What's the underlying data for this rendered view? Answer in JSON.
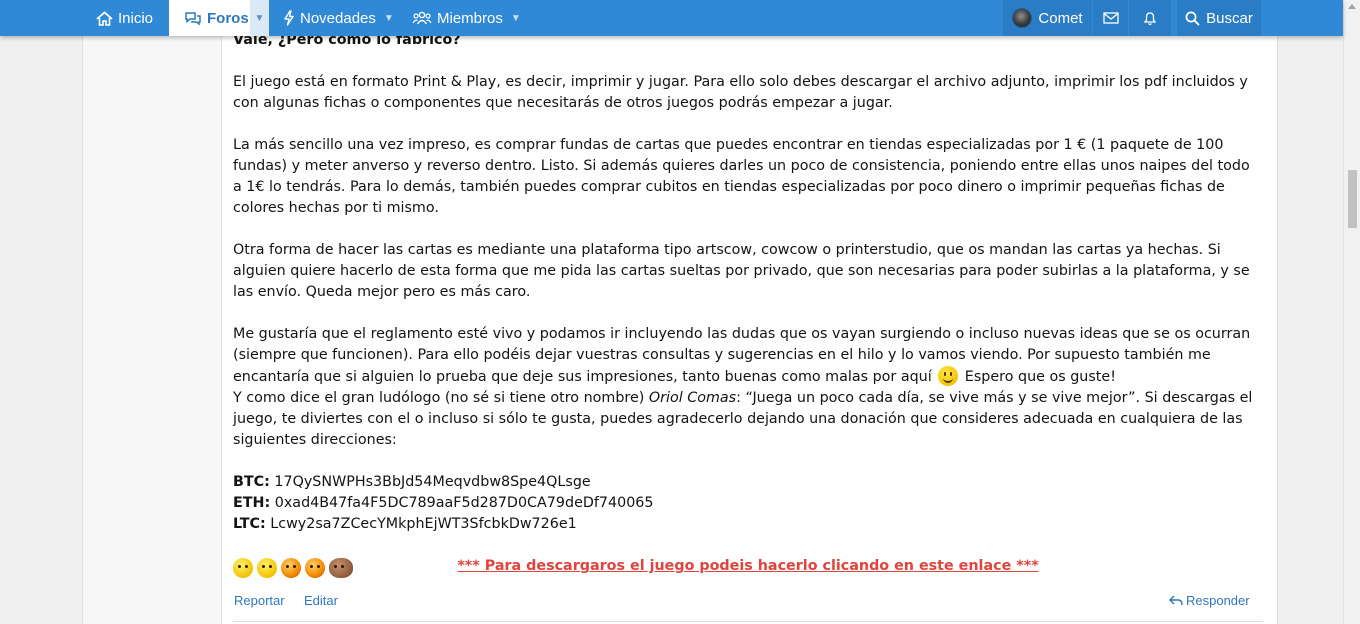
{
  "nav": {
    "home_label": "Inicio",
    "forums_label": "Foros",
    "news_label": "Novedades",
    "members_label": "Miembros",
    "user_name": "Comet",
    "search_label": "Buscar"
  },
  "post": {
    "heading": "Vale, ¿Pero cómo lo fabrico?",
    "p1": "El juego está en formato Print & Play, es decir, imprimir y jugar. Para ello solo debes descargar el archivo adjunto, imprimir los pdf incluidos y con algunas fichas o componentes que necesitarás de otros juegos podrás empezar a jugar.",
    "p2": "La más sencillo una vez impreso, es comprar fundas de cartas que puedes encontrar en tiendas especializadas por 1 € (1 paquete de 100 fundas) y meter anverso y reverso dentro. Listo. Si además quieres darles un poco de consistencia, poniendo entre ellas unos naipes del todo a 1€ lo tendrás. Para lo demás, también puedes comprar cubitos en tiendas especializadas por poco dinero o imprimir pequeñas fichas de colores hechas por ti mismo.",
    "p3": "Otra forma de hacer las cartas es mediante una plataforma tipo artscow, cowcow o printerstudio, que os mandan las cartas ya hechas. Si alguien quiere hacerlo de esta forma que me pida las cartas sueltas por privado, que son necesarias para poder subirlas a la plataforma, y se las envío. Queda mejor pero es más caro.",
    "p4_before_smiley": "Me gustaría que el reglamento esté vivo y podamos ir incluyendo las dudas que os vayan surgiendo o incluso nuevas ideas que se os ocurran (siempre que funcionen). Para ello podéis dejar vuestras consultas y sugerencias en el hilo y lo vamos viendo. Por supuesto también me encantaría que si alguien lo prueba que deje sus impresiones, tanto buenas como malas por aquí",
    "p4_after_smiley": " Espero que os guste!",
    "p5_before_name": "Y como dice el gran ludólogo (no sé si tiene otro nombre) ",
    "p5_name": "Oriol Comas",
    "p5_after_name": ": “Juega un poco cada día, se vive más y se vive mejor”. Si descargas el juego, te diviertes con el o incluso si sólo te gusta, puedes agradecerlo dejando una donación que consideres adecuada en cualquiera de las siguientes direcciones:",
    "btc_label": "BTC:",
    "btc_address": " 17QySNWPHs3BbJd54Meqvdbw8Spe4QLsge",
    "eth_label": "ETH:",
    "eth_address": " 0xad4B47fa4F5DC789aaF5d287D0CA79deDf740065",
    "ltc_label": "LTC:",
    "ltc_address": " Lcwy2sa7ZCecYMkphEjWT3SfcbkDw726e1",
    "download_link": "*** Para descargaros el juego podeis hacerlo clicando en este enlace ***"
  },
  "emotes": [
    "confused-emote",
    "confused-emote",
    "fire-emote",
    "fire-emote",
    "bear-emote"
  ],
  "actions": {
    "report_label": "Reportar",
    "edit_label": "Editar",
    "reply_label": "Responder"
  },
  "colors": {
    "nav_bg": "#2f89d6",
    "link": "#2f78c0",
    "download_link": "#e0443e"
  }
}
